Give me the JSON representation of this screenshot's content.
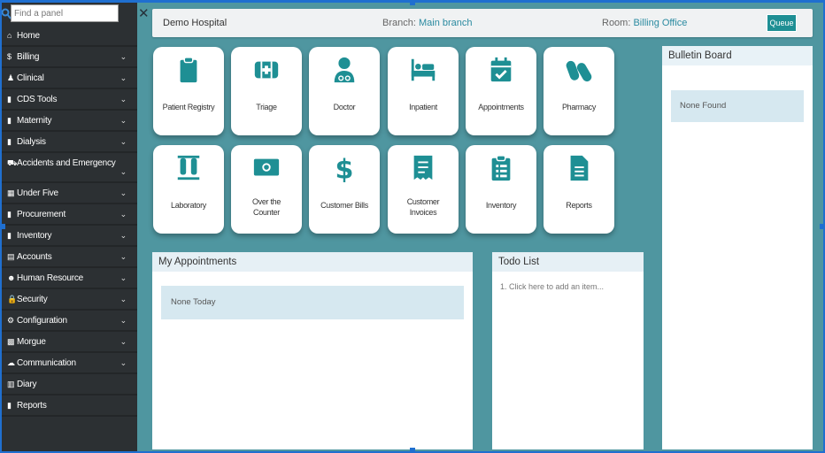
{
  "search": {
    "placeholder": "Find a panel"
  },
  "close_label": "✕",
  "sidebar": {
    "items": [
      {
        "label": "Home",
        "icon": "home-icon",
        "glyph": "⌂",
        "chevron": false
      },
      {
        "label": "Billing",
        "icon": "dollar-icon",
        "glyph": "$",
        "chevron": true
      },
      {
        "label": "Clinical",
        "icon": "user-md-icon",
        "glyph": "♟",
        "chevron": true
      },
      {
        "label": "CDS Tools",
        "icon": "file-icon",
        "glyph": "▮",
        "chevron": true
      },
      {
        "label": "Maternity",
        "icon": "file-icon",
        "glyph": "▮",
        "chevron": true
      },
      {
        "label": "Dialysis",
        "icon": "file-icon",
        "glyph": "▮",
        "chevron": true
      },
      {
        "label": "Accidents and Emergency",
        "icon": "ambulance-icon",
        "glyph": "⛟",
        "chevron": true
      },
      {
        "label": "Under Five",
        "icon": "table-icon",
        "glyph": "▦",
        "chevron": true
      },
      {
        "label": "Procurement",
        "icon": "file-icon",
        "glyph": "▮",
        "chevron": true
      },
      {
        "label": "Inventory",
        "icon": "file-icon",
        "glyph": "▮",
        "chevron": true
      },
      {
        "label": "Accounts",
        "icon": "calculator-icon",
        "glyph": "▤",
        "chevron": true
      },
      {
        "label": "Human Resource",
        "icon": "users-icon",
        "glyph": "☻",
        "chevron": true
      },
      {
        "label": "Security",
        "icon": "lock-icon",
        "glyph": "🔒",
        "chevron": true
      },
      {
        "label": "Configuration",
        "icon": "cogs-icon",
        "glyph": "⚙",
        "chevron": true
      },
      {
        "label": "Morgue",
        "icon": "store-icon",
        "glyph": "▩",
        "chevron": true
      },
      {
        "label": "Communication",
        "icon": "comments-icon",
        "glyph": "☁",
        "chevron": true
      },
      {
        "label": "Diary",
        "icon": "book-icon",
        "glyph": "▥",
        "chevron": false
      },
      {
        "label": "Reports",
        "icon": "report-icon",
        "glyph": "▮",
        "chevron": false
      }
    ]
  },
  "header": {
    "hospital": "Demo Hospital",
    "branch_label": "Branch:",
    "branch_value": "Main branch",
    "room_label": "Room:",
    "room_value": "Billing Office",
    "queue_button": "Queue"
  },
  "tiles": [
    {
      "label": "Patient Registry",
      "icon": "clipboard-icon"
    },
    {
      "label": "Triage",
      "icon": "first-aid-icon"
    },
    {
      "label": "Doctor",
      "icon": "doctor-icon"
    },
    {
      "label": "Inpatient",
      "icon": "bed-icon"
    },
    {
      "label": "Appointments",
      "icon": "calendar-check-icon"
    },
    {
      "label": "Pharmacy",
      "icon": "pills-icon"
    },
    {
      "label": "Laboratory",
      "icon": "test-tubes-icon"
    },
    {
      "label": "Over the",
      "label2": "Counter",
      "icon": "money-bill-icon"
    },
    {
      "label": "Customer Bills",
      "icon": "dollar-icon"
    },
    {
      "label": "Customer",
      "label2": "Invoices",
      "icon": "receipt-icon"
    },
    {
      "label": "Inventory",
      "icon": "clipboard-list-icon"
    },
    {
      "label": "Reports",
      "icon": "file-alt-icon"
    }
  ],
  "bulletin": {
    "title": "Bulletin Board",
    "empty": "None Found"
  },
  "appointments": {
    "title": "My Appointments",
    "empty": "None Today"
  },
  "todo": {
    "title": "Todo List",
    "placeholder": "1. Click here to add an item..."
  },
  "colors": {
    "accent": "#1e8f94",
    "sidebar_bg": "#2c3033",
    "page_bg": "#4f96a0",
    "selection": "#1f6fd0"
  }
}
